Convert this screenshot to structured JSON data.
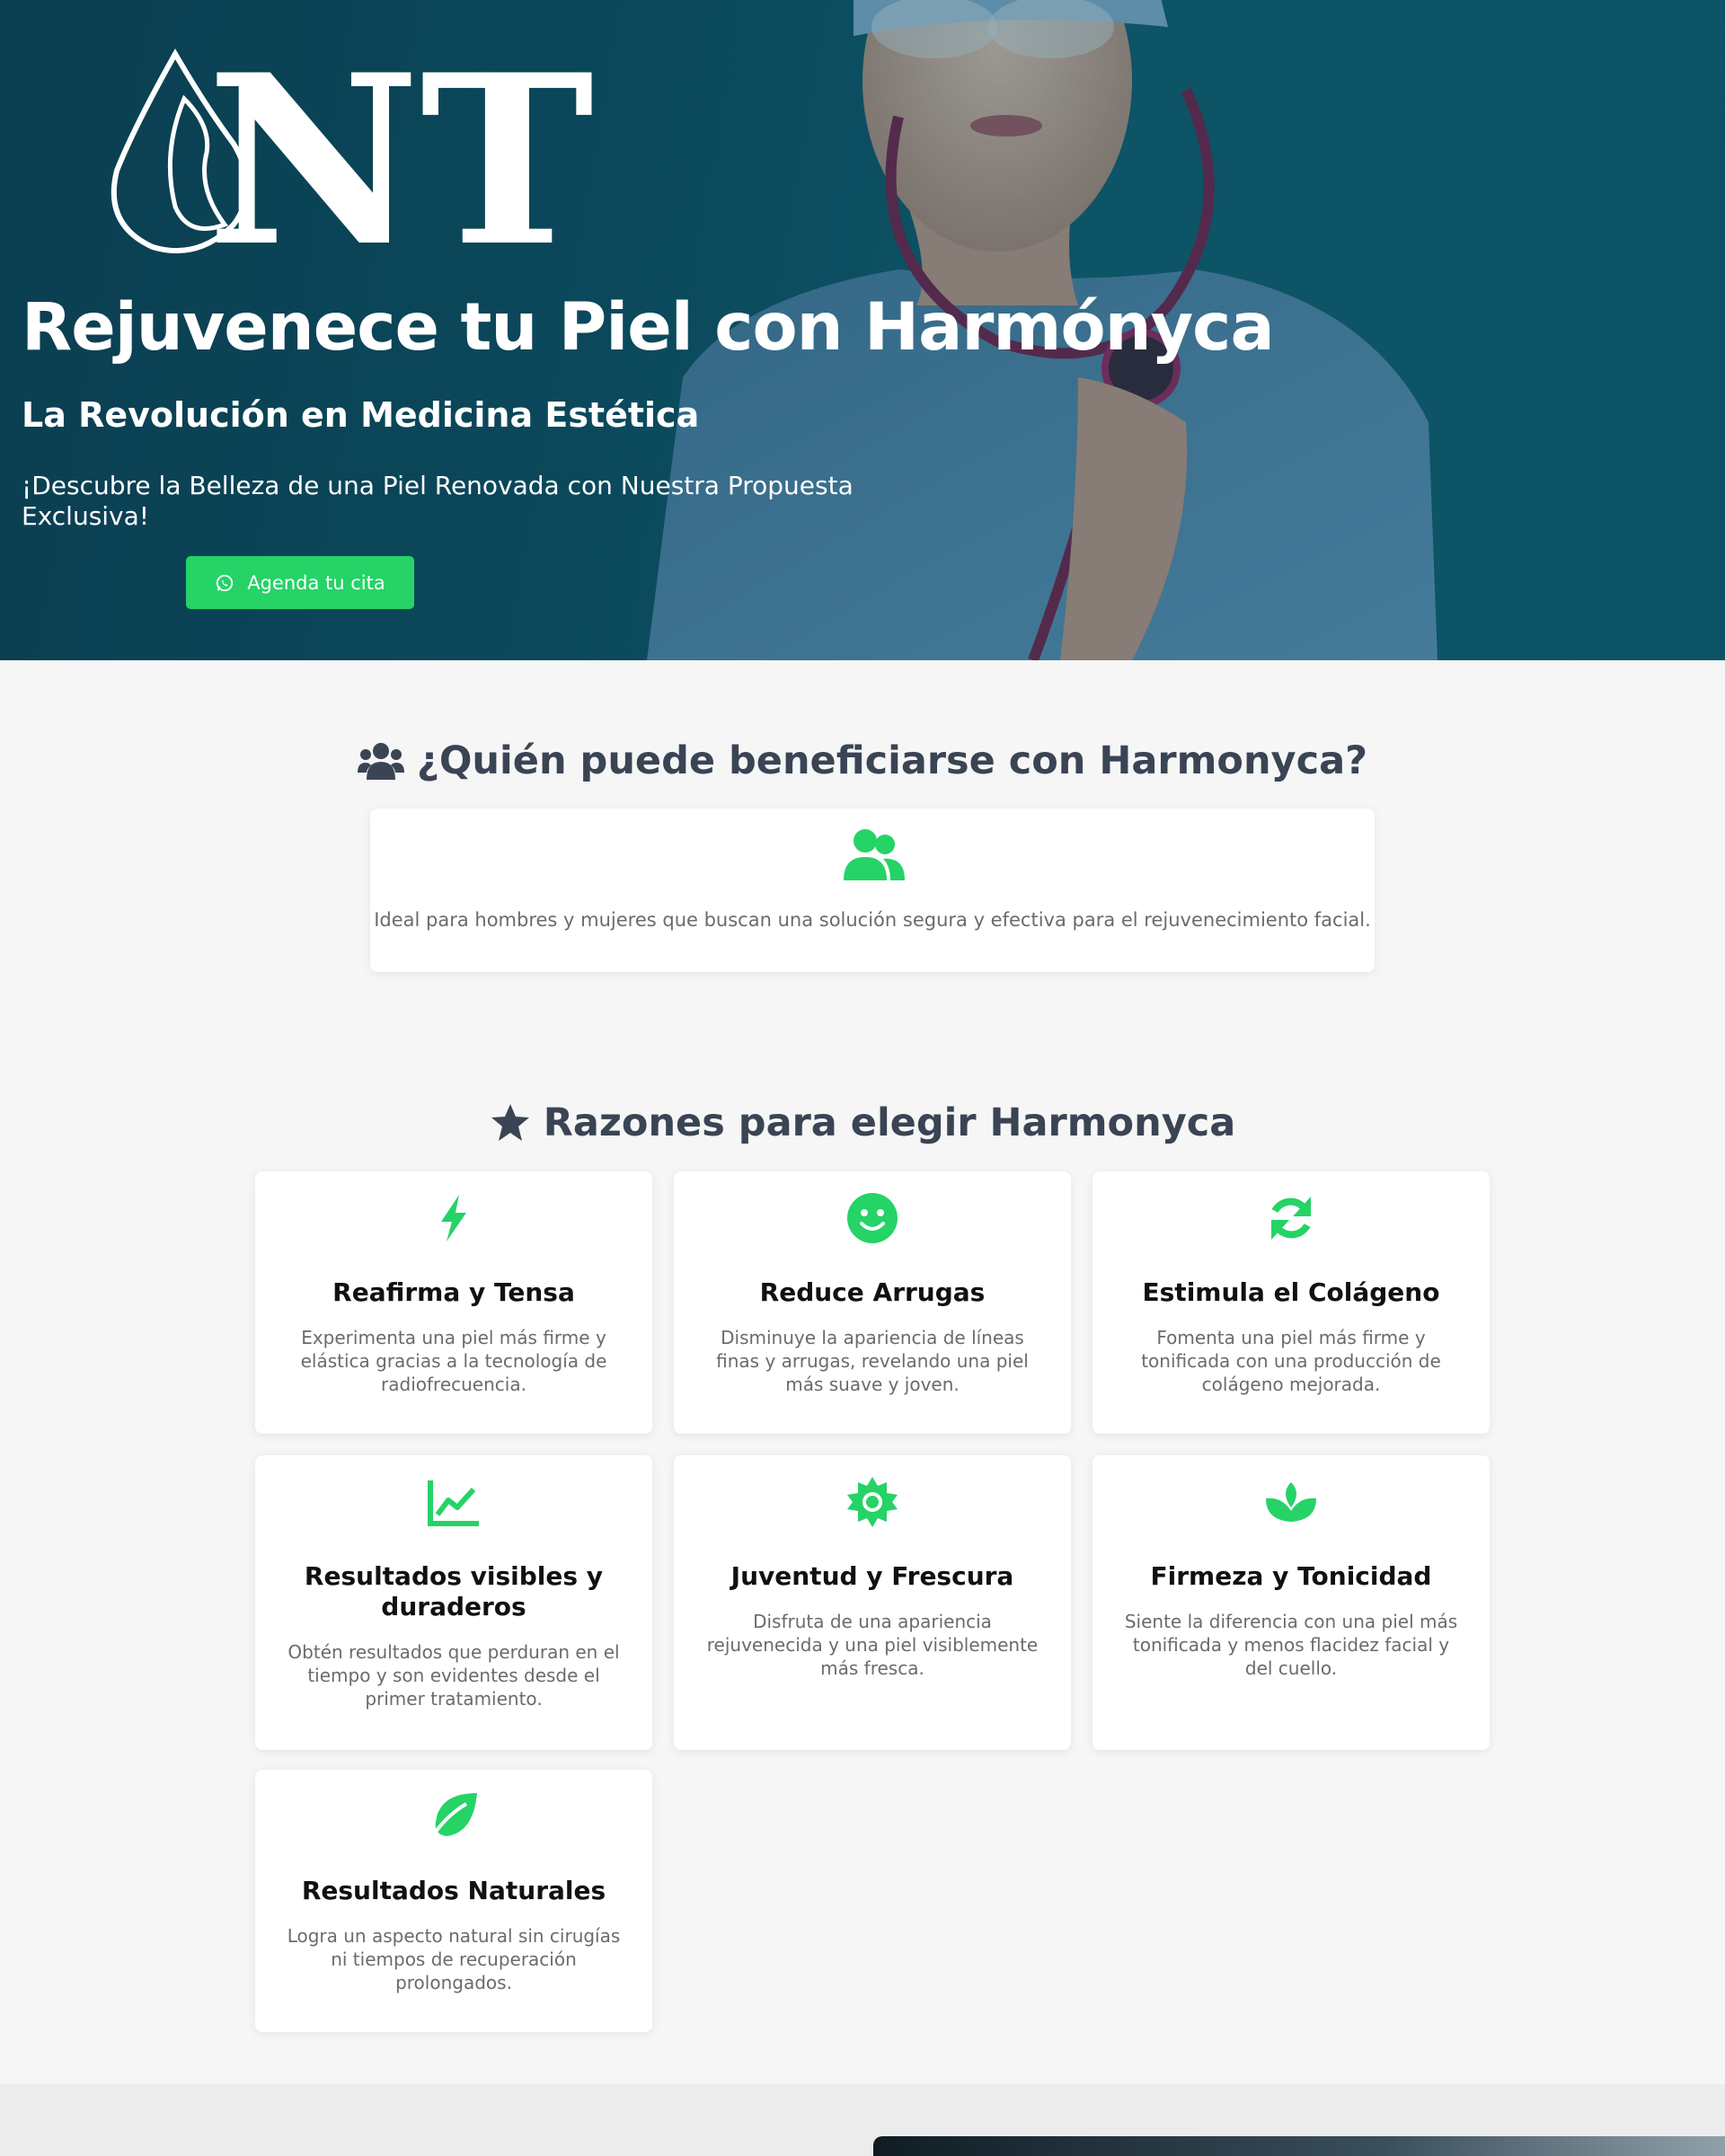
{
  "hero": {
    "logo_text": "NT",
    "title": "Rejuvenece tu Piel con Harmónyca",
    "subtitle": "La Revolución en Medicina Estética",
    "description": "¡Descubre la Belleza de una Piel Renovada con Nuestra Propuesta Exclusiva!",
    "cta_label": "Agenda tu cita",
    "cta_icon": "whatsapp-icon"
  },
  "who": {
    "title": "¿Quién puede beneficiarse con Harmonyca?",
    "title_icon": "users-icon",
    "card_icon": "user-group-icon",
    "text": "Ideal para hombres y mujeres que buscan una solución segura y efectiva para el rejuvenecimiento facial."
  },
  "reasons": {
    "title": "Razones para elegir Harmonyca",
    "title_icon": "star-icon",
    "items": [
      {
        "icon": "bolt-icon",
        "title": "Reafirma y Tensa",
        "text": "Experimenta una piel más firme y elástica gracias a la tecnología de radiofrecuencia."
      },
      {
        "icon": "smile-icon",
        "title": "Reduce Arrugas",
        "text": "Disminuye la apariencia de líneas finas y arrugas, revelando una piel más suave y joven."
      },
      {
        "icon": "refresh-icon",
        "title": "Estimula el Colágeno",
        "text": "Fomenta una piel más firme y tonificada con una producción de colágeno mejorada."
      },
      {
        "icon": "chart-line-icon",
        "title": "Resultados visibles y duraderos",
        "text": "Obtén resultados que perduran en el tiempo y son evidentes desde el primer tratamiento."
      },
      {
        "icon": "sun-icon",
        "title": "Juventud y Frescura",
        "text": "Disfruta de una apariencia rejuvenecida y una piel visiblemente más fresca."
      },
      {
        "icon": "spa-icon",
        "title": "Firmeza y Tonicidad",
        "text": "Siente la diferencia con una piel más tonificada y menos flacidez facial y del cuello."
      },
      {
        "icon": "leaf-icon",
        "title": "Resultados Naturales",
        "text": "Logra un aspecto natural sin cirugías ni tiempos de recuperación prolongados."
      }
    ]
  },
  "colors": {
    "accent": "#25d366",
    "heading": "#3a4454",
    "hero_bg": "#0c4a5e"
  }
}
